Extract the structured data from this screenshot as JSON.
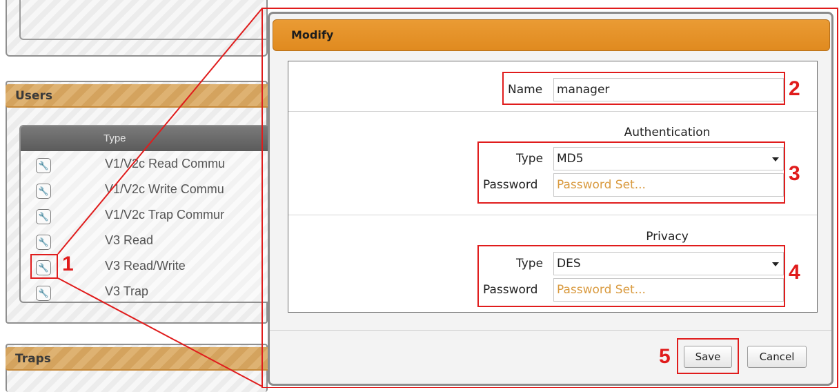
{
  "background": {
    "users_section": {
      "title": "Users",
      "column_header": "Type",
      "rows": [
        {
          "type": "V1/V2c Read Commu",
          "icon": "wrench-icon"
        },
        {
          "type": "V1/V2c Write Commu",
          "icon": "wrench-icon"
        },
        {
          "type": "V1/V2c Trap Commur",
          "icon": "wrench-icon"
        },
        {
          "type": "V3 Read",
          "icon": "wrench-icon"
        },
        {
          "type": "V3 Read/Write",
          "icon": "wrench-icon"
        },
        {
          "type": "V3 Trap",
          "icon": "wrench-icon"
        }
      ]
    },
    "traps_section": {
      "title": "Traps"
    }
  },
  "dialog": {
    "title": "Modify",
    "name": {
      "label": "Name",
      "value": "manager"
    },
    "authentication": {
      "heading": "Authentication",
      "type_label": "Type",
      "type_value": "MD5",
      "password_label": "Password",
      "password_placeholder": "Password Set..."
    },
    "privacy": {
      "heading": "Privacy",
      "type_label": "Type",
      "type_value": "DES",
      "password_label": "Password",
      "password_placeholder": "Password Set..."
    },
    "buttons": {
      "save": "Save",
      "cancel": "Cancel"
    }
  },
  "callouts": [
    "1",
    "2",
    "3",
    "4",
    "5"
  ],
  "colors": {
    "accent_orange": "#e08a1f",
    "callout_red": "#e01c1c",
    "placeholder_orange": "#d99a3f"
  }
}
